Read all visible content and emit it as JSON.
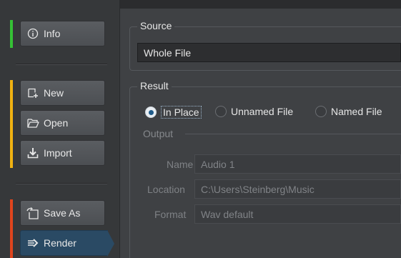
{
  "sidebar": {
    "info_label": "Info",
    "new_label": "New",
    "open_label": "Open",
    "import_label": "Import",
    "save_as_label": "Save As",
    "render_label": "Render"
  },
  "source": {
    "legend": "Source",
    "value": "Whole File"
  },
  "result": {
    "legend": "Result",
    "options": [
      "In Place",
      "Unnamed File",
      "Named File"
    ],
    "selected": "In Place"
  },
  "output": {
    "legend": "Output",
    "name_label": "Name",
    "name_value": "Audio 1",
    "location_label": "Location",
    "location_value": "C:\\Users\\Steinberg\\Music",
    "format_label": "Format",
    "format_value": "Wav default"
  },
  "colors": {
    "info_stripe": "#35c135",
    "file_stripe": "#f0b211",
    "output_stripe": "#e0451d",
    "render_active": "#2a4a64"
  }
}
